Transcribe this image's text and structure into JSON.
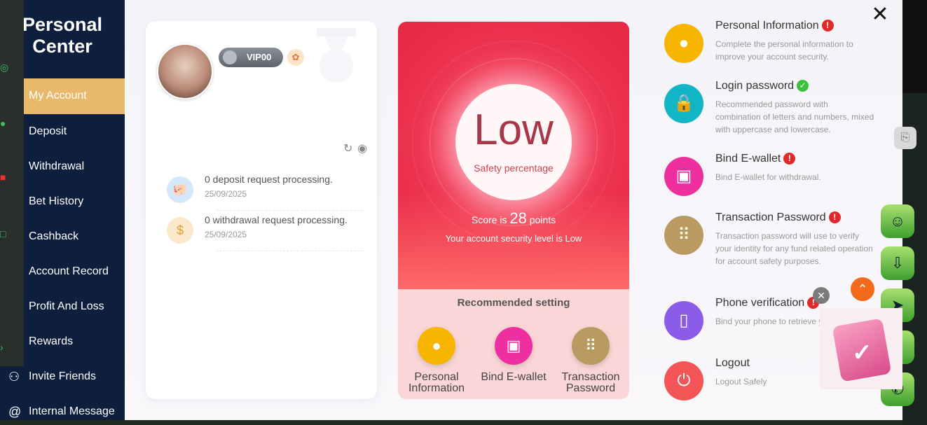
{
  "sidebar": {
    "title_line1": "Personal",
    "title_line2": "Center",
    "items": [
      {
        "label": "My Account",
        "icon": "user-icon"
      },
      {
        "label": "Deposit",
        "icon": "wallet-icon"
      },
      {
        "label": "Withdrawal",
        "icon": "cash-icon"
      },
      {
        "label": "Bet History",
        "icon": "history-icon"
      },
      {
        "label": "Cashback",
        "icon": "cashback-icon"
      },
      {
        "label": "Account Record",
        "icon": "record-icon"
      },
      {
        "label": "Profit And Loss",
        "icon": "chart-icon"
      },
      {
        "label": "Rewards",
        "icon": "gift-icon"
      },
      {
        "label": "Invite Friends",
        "icon": "friends-icon"
      },
      {
        "label": "Internal Message",
        "icon": "at-icon"
      }
    ]
  },
  "profile": {
    "vip_label": "VIP00",
    "requests": [
      {
        "text": "0 deposit request processing.",
        "date": "25/09/2025",
        "icon": "piggy-bank-icon"
      },
      {
        "text": "0 withdrawal request processing.",
        "date": "25/09/2025",
        "icon": "money-icon"
      }
    ]
  },
  "security": {
    "level_word": "Low",
    "safety_label": "Safety percentage",
    "score_prefix": "Score is",
    "score_value": "28",
    "score_suffix": "points",
    "level_text": "Your account security level is Low",
    "recommended_title": "Recommended setting",
    "recommended": [
      {
        "line1": "Personal",
        "line2": "Information",
        "icon": "user-icon",
        "color": "#f7b500"
      },
      {
        "line1": "Bind E-wallet",
        "line2": "",
        "icon": "ewallet-icon",
        "color": "#ee2fa0"
      },
      {
        "line1": "Transaction",
        "line2": "Password",
        "icon": "keypad-icon",
        "color": "#b99a60"
      }
    ]
  },
  "settings": [
    {
      "title": "Personal Information",
      "desc": "Complete the personal information to improve your account security.",
      "status": "warning",
      "icon": "user-icon",
      "color": "#f7b500"
    },
    {
      "title": "Login password",
      "desc": "Recommended password with combination of letters and numbers, mixed with uppercase and lowercase.",
      "status": "ok",
      "icon": "lock-icon",
      "color": "#12b5c6"
    },
    {
      "title": "Bind E-wallet",
      "desc": "Bind E-wallet for withdrawal.",
      "status": "warning",
      "icon": "ewallet-icon",
      "color": "#ee2fa0"
    },
    {
      "title": "Transaction Password",
      "desc": "Transaction password will use to verify your identity for any fund related operation for account safety purposes.",
      "status": "warning",
      "icon": "keypad-icon",
      "color": "#b99a60"
    },
    {
      "title": "Phone verification",
      "desc": "Bind your phone to retrieve yo password.",
      "status": "warning",
      "icon": "phone-icon",
      "color": "#8a5ce8"
    },
    {
      "title": "Logout",
      "desc": "Logout Safely",
      "status": "none",
      "icon": "power-icon",
      "color": "#f25555"
    }
  ],
  "floating": [
    "support-icon",
    "download-icon",
    "telegram-icon",
    "facebook-icon",
    "whatsapp-icon"
  ]
}
